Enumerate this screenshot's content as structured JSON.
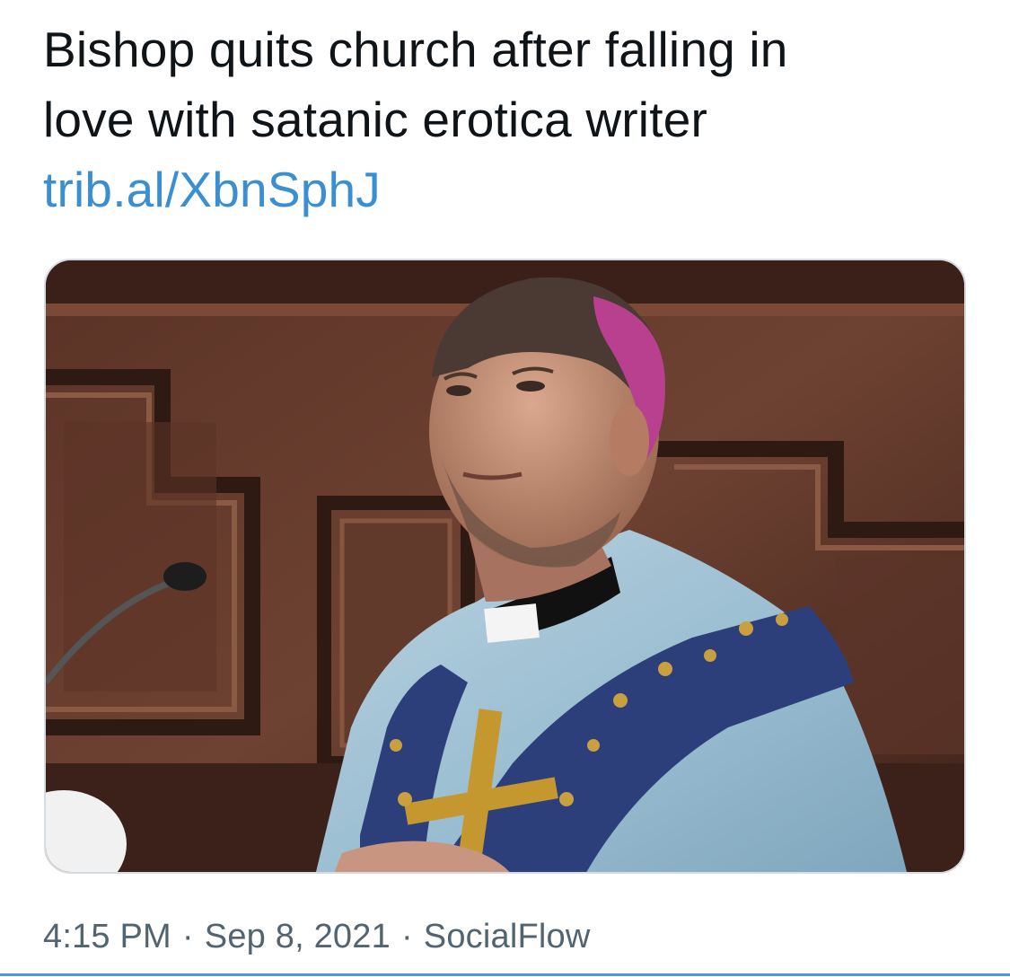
{
  "tweet": {
    "text_line1": "Bishop quits church after falling in",
    "text_line2": "love with satanic erotica writer",
    "link": "trib.al/XbnSphJ",
    "time": "4:15 PM",
    "separator": "·",
    "date": "Sep 8, 2021",
    "source": "SocialFlow"
  },
  "colors": {
    "text": "#0f1419",
    "link": "#3b8fd0",
    "meta": "#536471",
    "accent_divider": "#4a9ad6"
  },
  "media": {
    "description_icon": "photo-bishop-in-vestments"
  }
}
